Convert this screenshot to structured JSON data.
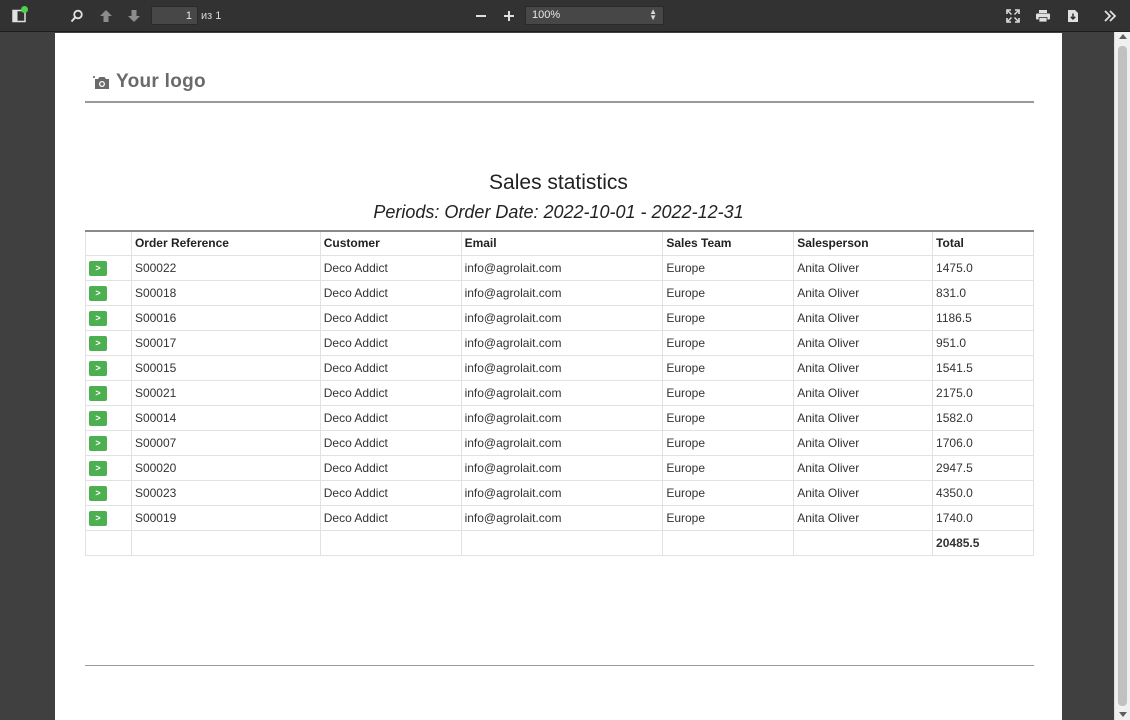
{
  "toolbar": {
    "page_current": "1",
    "page_count": "из 1",
    "zoom": "100%"
  },
  "document": {
    "logo_text": "Your logo",
    "title": "Sales statistics",
    "subtitle": "Periods: Order Date: 2022-10-01 - 2022-12-31"
  },
  "table": {
    "headers": [
      "",
      "Order Reference",
      "Customer",
      "Email",
      "Sales Team",
      "Salesperson",
      "Total"
    ],
    "open_label": ">",
    "rows": [
      {
        "ref": "S00022",
        "customer": "Deco Addict",
        "email": "info@agrolait.com",
        "team": "Europe",
        "salesperson": "Anita Oliver",
        "total": "1475.0"
      },
      {
        "ref": "S00018",
        "customer": "Deco Addict",
        "email": "info@agrolait.com",
        "team": "Europe",
        "salesperson": "Anita Oliver",
        "total": "831.0"
      },
      {
        "ref": "S00016",
        "customer": "Deco Addict",
        "email": "info@agrolait.com",
        "team": "Europe",
        "salesperson": "Anita Oliver",
        "total": "1186.5"
      },
      {
        "ref": "S00017",
        "customer": "Deco Addict",
        "email": "info@agrolait.com",
        "team": "Europe",
        "salesperson": "Anita Oliver",
        "total": "951.0"
      },
      {
        "ref": "S00015",
        "customer": "Deco Addict",
        "email": "info@agrolait.com",
        "team": "Europe",
        "salesperson": "Anita Oliver",
        "total": "1541.5"
      },
      {
        "ref": "S00021",
        "customer": "Deco Addict",
        "email": "info@agrolait.com",
        "team": "Europe",
        "salesperson": "Anita Oliver",
        "total": "2175.0"
      },
      {
        "ref": "S00014",
        "customer": "Deco Addict",
        "email": "info@agrolait.com",
        "team": "Europe",
        "salesperson": "Anita Oliver",
        "total": "1582.0"
      },
      {
        "ref": "S00007",
        "customer": "Deco Addict",
        "email": "info@agrolait.com",
        "team": "Europe",
        "salesperson": "Anita Oliver",
        "total": "1706.0"
      },
      {
        "ref": "S00020",
        "customer": "Deco Addict",
        "email": "info@agrolait.com",
        "team": "Europe",
        "salesperson": "Anita Oliver",
        "total": "2947.5"
      },
      {
        "ref": "S00023",
        "customer": "Deco Addict",
        "email": "info@agrolait.com",
        "team": "Europe",
        "salesperson": "Anita Oliver",
        "total": "4350.0"
      },
      {
        "ref": "S00019",
        "customer": "Deco Addict",
        "email": "info@agrolait.com",
        "team": "Europe",
        "salesperson": "Anita Oliver",
        "total": "1740.0"
      }
    ],
    "grand_total": "20485.5"
  },
  "colors": {
    "toolbar_bg": "#323232",
    "viewer_bg": "#404040",
    "button_green": "#4caf50"
  },
  "icons": {
    "sidebar": "sidebar-toggle-icon",
    "find": "search-icon",
    "previous": "arrow-up-icon",
    "next": "arrow-down-icon",
    "zoom_out": "minus-icon",
    "zoom_in": "plus-icon",
    "presentation": "fullscreen-icon",
    "print": "print-icon",
    "download": "download-icon",
    "tools": "double-chevron-right-icon",
    "logo": "camera-icon"
  }
}
